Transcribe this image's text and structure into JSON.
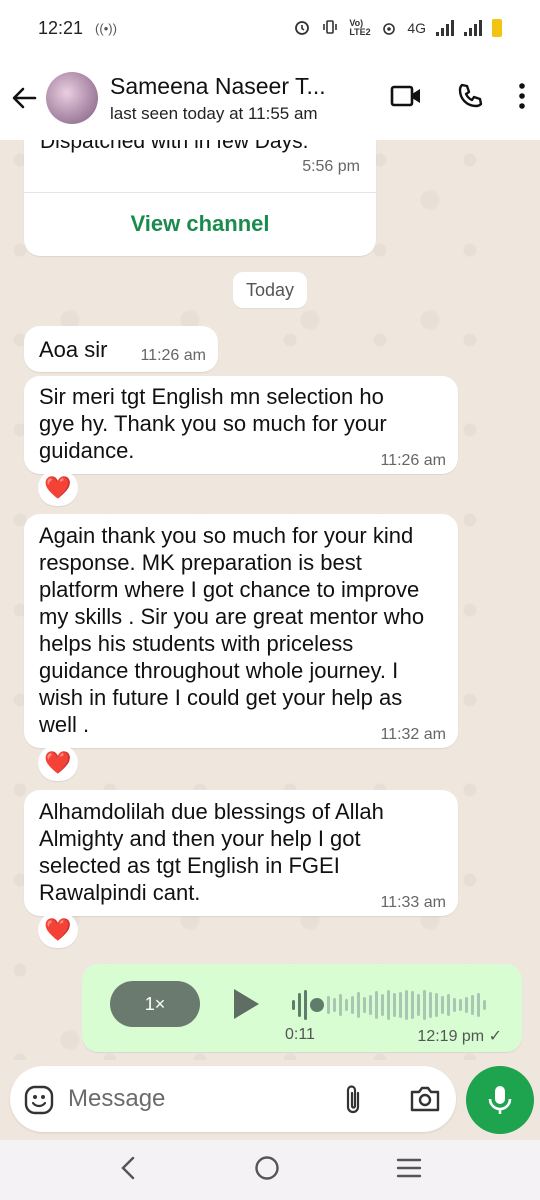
{
  "status_bar": {
    "time": "12:21",
    "network": "4G",
    "volte": "Vo) LTE2"
  },
  "header": {
    "contact_name": "Sameena Naseer T...",
    "last_seen": "last seen today at 11:55 am"
  },
  "channel_card": {
    "text": "Dispatched with in few Days.",
    "time": "5:56 pm",
    "button_label": "View channel"
  },
  "date_chip": "Today",
  "messages": [
    {
      "text": "Aoa sir",
      "time": "11:26 am",
      "reaction": "❤️"
    },
    {
      "text": "Sir meri tgt English mn selection ho gye hy. Thank you so much for your guidance.",
      "time": "11:26 am",
      "reaction": "❤️"
    },
    {
      "text": "Again thank you so much for your kind response. MK preparation is best platform where I got chance to improve my skills . Sir you are great mentor who helps his students  with priceless guidance throughout whole journey. I wish in future I could get your help as well .",
      "time": "11:32 am",
      "reaction": "❤️"
    },
    {
      "text": "Alhamdolilah due blessings of Allah Almighty and then your help I got selected as tgt English in FGEI Rawalpindi cant.",
      "time": "11:33 am",
      "reaction": "❤️"
    }
  ],
  "voice_message": {
    "speed": "1×",
    "duration": "0:11",
    "time": "12:19 pm",
    "status": "✓",
    "progress": 0.05
  },
  "composer": {
    "placeholder": "Message"
  },
  "colors": {
    "accent": "#1ea34f",
    "outgoing_bubble": "#d8fdd2",
    "link": "#1b8a4e",
    "heart": "#e0283a"
  }
}
